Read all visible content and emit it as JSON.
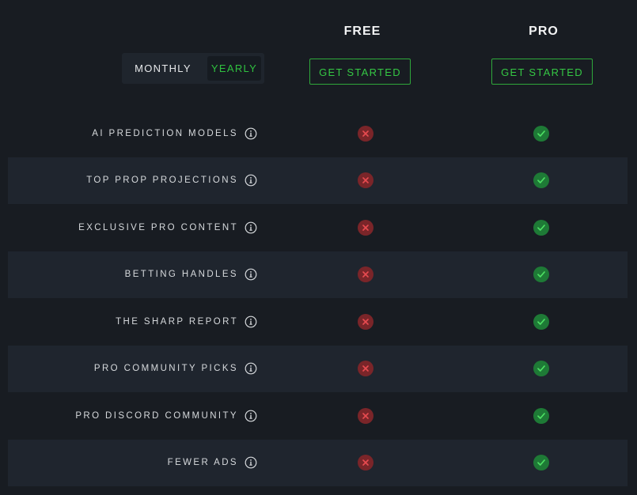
{
  "plans": {
    "free": {
      "name": "FREE",
      "cta": "GET STARTED"
    },
    "pro": {
      "name": "PRO",
      "cta": "GET STARTED"
    }
  },
  "billing_toggle": {
    "options": [
      "MONTHLY",
      "YEARLY"
    ],
    "selected": "YEARLY"
  },
  "features": [
    {
      "label": "AI PREDICTION MODELS",
      "free": false,
      "pro": true
    },
    {
      "label": "TOP PROP PROJECTIONS",
      "free": false,
      "pro": true
    },
    {
      "label": "EXCLUSIVE PRO CONTENT",
      "free": false,
      "pro": true
    },
    {
      "label": "BETTING HANDLES",
      "free": false,
      "pro": true
    },
    {
      "label": "THE SHARP REPORT",
      "free": false,
      "pro": true
    },
    {
      "label": "PRO COMMUNITY PICKS",
      "free": false,
      "pro": true
    },
    {
      "label": "PRO DISCORD COMMUNITY",
      "free": false,
      "pro": true
    },
    {
      "label": "FEWER ADS",
      "free": false,
      "pro": true
    }
  ],
  "colors": {
    "background": "#181c22",
    "row_alt": "#1f252e",
    "accent_green": "#35c744",
    "no_red": "#7a2529",
    "yes_green": "#1e7a36"
  },
  "icons": {
    "info": "info-icon",
    "no": "x-icon",
    "yes": "check-icon"
  }
}
